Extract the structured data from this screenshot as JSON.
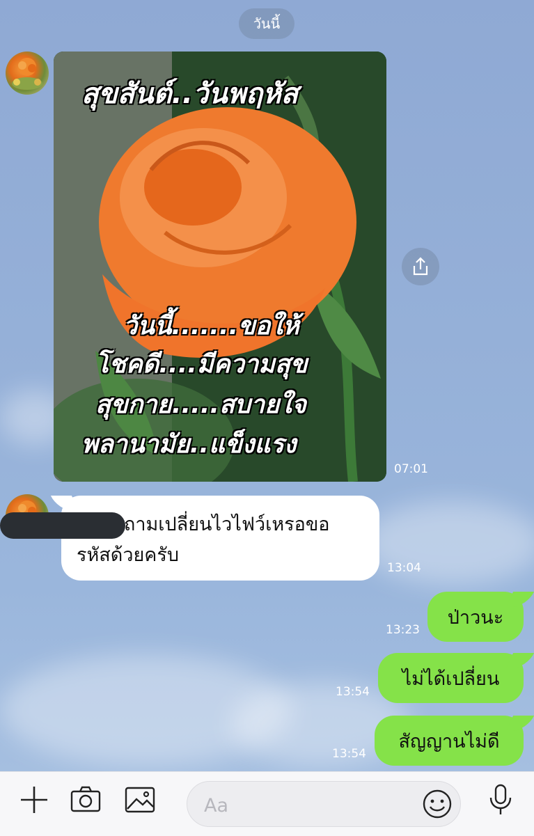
{
  "date_label": "วันนี้",
  "messages": [
    {
      "side": "left",
      "type": "image",
      "overlay_title": "สุขสันต์..วันพฤหัส",
      "overlay_lines": [
        "วันนี้.......ขอให้",
        "โชคดี....มีความสุข",
        "สุขกาย.....สบายใจ",
        "พลานามัย..แข็งแรง"
      ],
      "time": "07:01"
    },
    {
      "side": "left",
      "type": "text",
      "text_line1": "ถามเปลี่ยนไวไฟว์เหรอขอ",
      "text_line2": "รหัสด้วยครับ",
      "time": "13:04"
    },
    {
      "side": "right",
      "type": "text",
      "text": "ป่าวนะ",
      "time": "13:23"
    },
    {
      "side": "right",
      "type": "text",
      "text": "ไม่ได้เปลี่ยน",
      "time": "13:54"
    },
    {
      "side": "right",
      "type": "text",
      "text": "สัญญานไม่ดี",
      "time": "13:54"
    }
  ],
  "input": {
    "placeholder": "Aa"
  },
  "colors": {
    "outgoing_bubble": "#85e249",
    "incoming_bubble": "#ffffff"
  },
  "icons": {
    "add": "plus-icon",
    "camera": "camera-icon",
    "gallery": "image-icon",
    "sticker": "emoji-icon",
    "voice": "microphone-icon",
    "share": "share-icon"
  }
}
